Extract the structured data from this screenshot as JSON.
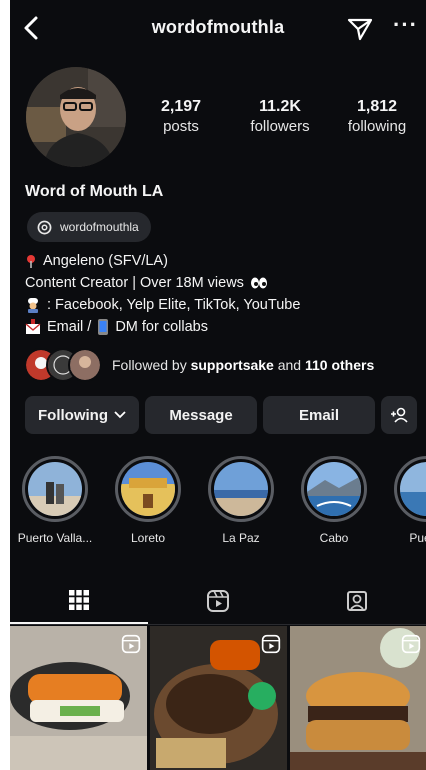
{
  "header": {
    "username": "wordofmouthla",
    "more_label": "···"
  },
  "profile": {
    "stats": [
      {
        "value": "2,197",
        "label": "posts"
      },
      {
        "value": "11.2K",
        "label": "followers"
      },
      {
        "value": "1,812",
        "label": "following"
      }
    ],
    "display_name": "Word of Mouth LA",
    "threads_handle": "wordofmouthla",
    "bio": {
      "line1": "Angeleno (SFV/LA)",
      "line2": "Content Creator | Over 18M views",
      "line3": ": Facebook, Yelp Elite, TikTok, YouTube",
      "line4_a": "Email /",
      "line4_b": "DM for collabs"
    },
    "followed_by": {
      "prefix": "Followed by",
      "user": "supportsake",
      "joiner": "and",
      "others": "110 others"
    }
  },
  "actions": {
    "following": "Following",
    "message": "Message",
    "email": "Email"
  },
  "highlights": [
    {
      "label": "Puerto Valla..."
    },
    {
      "label": "Loreto"
    },
    {
      "label": "La Paz"
    },
    {
      "label": "Cabo"
    },
    {
      "label": "Puerto"
    }
  ],
  "icons": {
    "back": "back-chevron-icon",
    "send": "send-icon",
    "threads": "threads-icon",
    "grid": "grid-icon",
    "reels": "reels-icon",
    "tagged": "tagged-icon",
    "add_person": "add-person-icon"
  },
  "colors": {
    "background": "#0b0c0f",
    "button": "#26282d",
    "text": "#f5f5f5"
  }
}
